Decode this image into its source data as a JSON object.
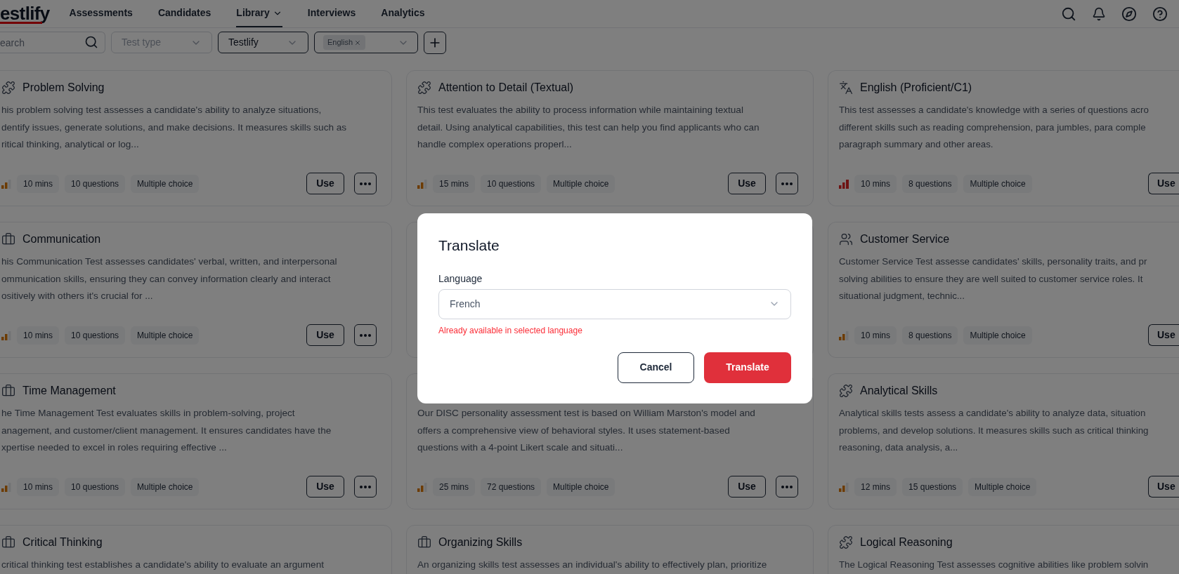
{
  "logo": {
    "text": "estlify"
  },
  "nav": [
    {
      "label": "Assessments",
      "selected": false,
      "dropdown": false
    },
    {
      "label": "Candidates",
      "selected": false,
      "dropdown": false
    },
    {
      "label": "Library",
      "selected": true,
      "dropdown": true
    },
    {
      "label": "Interviews",
      "selected": false,
      "dropdown": false
    },
    {
      "label": "Analytics",
      "selected": false,
      "dropdown": false
    }
  ],
  "filters": [
    {
      "kind": "search",
      "placeholder": "earch"
    },
    {
      "kind": "select",
      "placeholder": "Test type"
    },
    {
      "kind": "select",
      "value": "Testlify"
    },
    {
      "kind": "tags",
      "tags": [
        "English"
      ]
    },
    {
      "kind": "add"
    }
  ],
  "rows": [
    [
      {
        "kind": "puzzle",
        "title": "Problem Solving",
        "description": "his problem solving test assesses a candidate's ability to analyze situations,\ndentify issues, generate solutions, and make decisions. It measures skills such as\nritical thinking, analytical or log...",
        "level": 0.67,
        "meta": [
          "10 mins",
          "10 questions",
          "Multiple choice"
        ],
        "action": "Use"
      },
      {
        "kind": "puzzle",
        "title": "Attention to Detail (Textual)",
        "description": "This test evaluates the ability to process information while maintaining textual\ndetail. Using analytical capabilities, this test can help you find applicants who can\nhandle complex operations properl...",
        "level": 0.67,
        "meta": [
          "15 mins",
          "10 questions",
          "Multiple choice"
        ],
        "action": "Use"
      },
      {
        "kind": "language",
        "title": "English (Proficient/C1)",
        "description": "This test assesses a candidate's knowledge with a series of questions acro\ndifferent skills such as reading comprehension, para jumbles, para comple\nparagraph summary and other areas.",
        "level": 1,
        "meta": [
          "10 mins",
          "8 questions",
          "Multiple choice"
        ],
        "action": "Use"
      }
    ],
    [
      {
        "kind": "briefcase",
        "title": "Communication",
        "description": "his Communication Test assesses candidates' verbal, written, and interpersonal\nommunication skills, ensuring they can convey information clearly and interact\nositively with others it's crucial for ...",
        "level": 0.67,
        "meta": [
          "10 mins",
          "10 questions",
          "Multiple choice"
        ],
        "action": "Use"
      },
      {
        "kind": "covered"
      },
      {
        "kind": "people",
        "title": "Customer Service",
        "description": "Customer Service Test assesse candidates' skills, personality traits, and pr\nsolving abilities to ensure they are well suited to customer service roles. It\nsituational judgment, technic...",
        "level": 0.67,
        "meta": [
          "10 mins",
          "8 questions",
          "Multiple choice"
        ],
        "action": "Use"
      }
    ],
    [
      {
        "kind": "briefcase",
        "title": "Time Management",
        "description": "he Time Management Test evaluates skills in problem-solving, project\nanagement, and customer/client management. It ensures candidates have the\nxpertise needed to excel in roles requiring effective ...",
        "level": 0.67,
        "meta": [
          "10 mins",
          "10 questions",
          "Multiple choice"
        ],
        "action": "Use"
      },
      {
        "kind": "covered",
        "description": "Our DISC personality assessment test is based on William Marston's model and\noffers a comprehensive view of behavioral styles. It uses statement-based\nquestions with a 4-point Likert scale and situati...",
        "level": 0.67,
        "meta": [
          "25 mins",
          "72 questions",
          "Multiple choice"
        ],
        "action": "Use"
      },
      {
        "kind": "puzzle",
        "title": "Analytical Skills",
        "description": "Analytical skills tests assess a candidate's ability to analyze data, situation\nproblems, and develop solutions. It measures skills such as critical thinking\nreasoning, data analysis, a...",
        "level": 0.67,
        "meta": [
          "12 mins",
          "15 questions",
          "Multiple choice"
        ],
        "action": "Use"
      }
    ],
    [
      {
        "kind": "briefcase",
        "title": "Critical Thinking",
        "description": "critical thinking test establishes a candidate's ability to evaluate an argument"
      },
      {
        "kind": "briefcase",
        "title": "Organizing Skills",
        "description": "An organizing skills test assesses an individual's ability to effectively plan, prioritize"
      },
      {
        "kind": "puzzle",
        "title": "Logical Reasoning",
        "description": "The Logical Reasoning Test assesses cognitive abilities like problem solvin"
      }
    ]
  ],
  "dialog": {
    "title": "Translate",
    "field_label": "Language",
    "value": "French",
    "error": "Already available in selected language",
    "buttons": [
      {
        "label": "Cancel",
        "kind": "secondary"
      },
      {
        "label": "Translate",
        "kind": "primary"
      }
    ]
  }
}
